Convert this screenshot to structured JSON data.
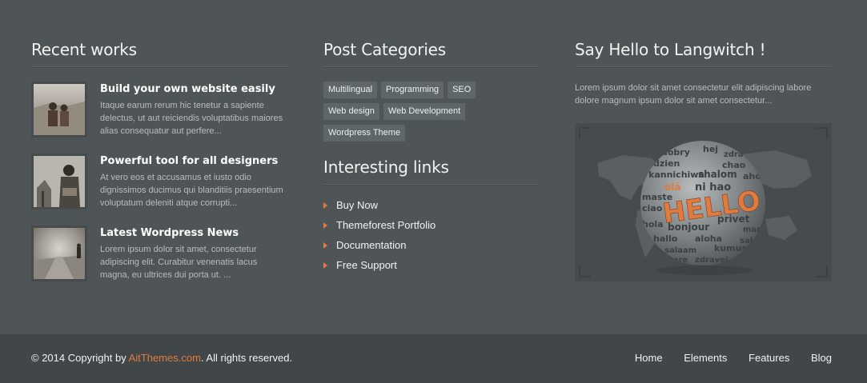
{
  "recent_works": {
    "title": "Recent works",
    "items": [
      {
        "title": "Build your own website easily",
        "text": "Itaque earum rerum hic tenetur a sapiente delectus, ut aut reiciendis voluptatibus maiores alias consequatur aut perfere..."
      },
      {
        "title": "Powerful tool for all designers",
        "text": "At vero eos et accusamus et iusto odio dignissimos ducimus qui blanditiis praesentium voluptatum deleniti atque corrupti..."
      },
      {
        "title": "Latest Wordpress News",
        "text": "Lorem ipsum dolor sit amet, consectetur adipiscing elit. Curabitur venenatis lacus magna, eu ultrices dui porta ut. ..."
      }
    ]
  },
  "post_categories": {
    "title": "Post Categories",
    "tags": [
      "Multilingual",
      "Programming",
      "SEO",
      "Web design",
      "Web Development",
      "Wordpress Theme"
    ]
  },
  "interesting_links": {
    "title": "Interesting links",
    "items": [
      "Buy Now",
      "Themeforest Portfolio",
      "Documentation",
      "Free Support"
    ]
  },
  "say_hello": {
    "title": "Say Hello to Langwitch !",
    "text": "Lorem ipsum dolor sit amet consectetur elit adipiscing labore dolore magnum ipsum dolor sit amet consectetur...",
    "image": {
      "globe_word": "HELLO",
      "globe_words": [
        "dobry",
        "hej",
        "zdravo",
        "chao",
        "dzien",
        "kannichiwa",
        "shalom",
        "ahoj",
        "olá",
        "ni hao",
        "maste",
        "ciao",
        "hola",
        "bonjour",
        "privet",
        "marhaba",
        "hallo",
        "aloha",
        "kumusta",
        "salaam",
        "zdravei",
        "tere",
        "salut"
      ]
    }
  },
  "footer": {
    "copyright_prefix": "© 2014 Copyright by ",
    "brand": "AitThemes.com",
    "copyright_suffix": ". All rights reserved.",
    "nav": [
      "Home",
      "Elements",
      "Features",
      "Blog"
    ]
  },
  "colors": {
    "accent": "#e07a3e",
    "background": "#4f5557",
    "footer": "#414749"
  }
}
